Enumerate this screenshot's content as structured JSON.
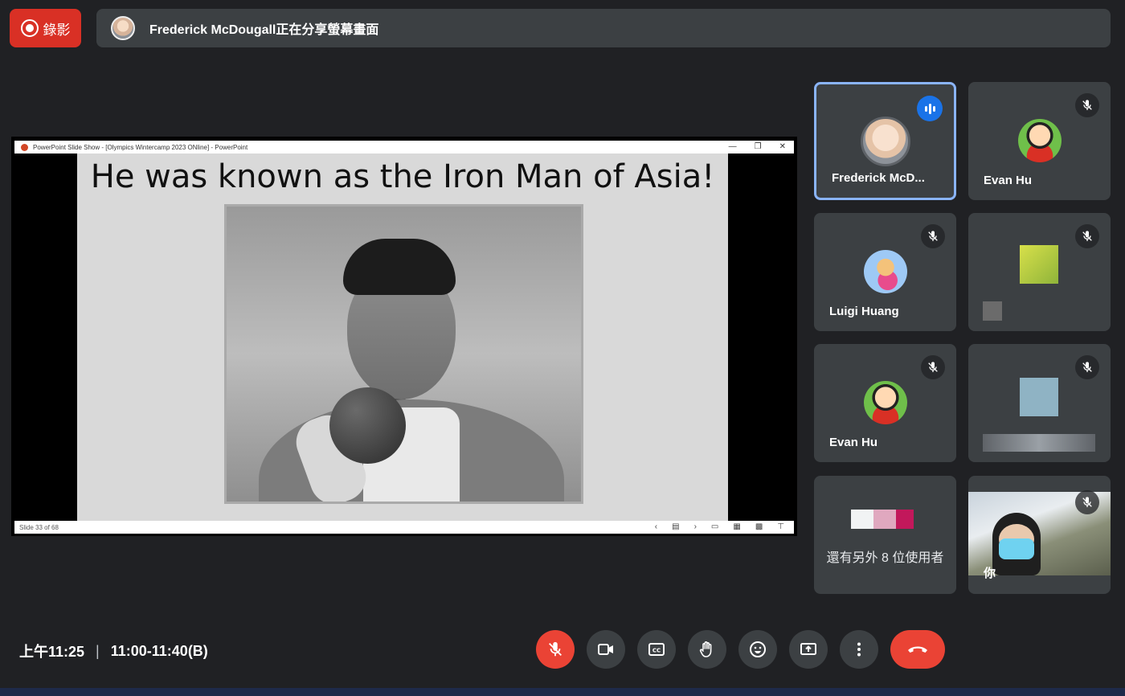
{
  "topbar": {
    "record_label": "錄影",
    "share_text": "Frederick McDougall正在分享螢幕畫面"
  },
  "presentation": {
    "window_title": "PowerPoint Slide Show - [Olympics Wintercamp 2023 ONline] - PowerPoint",
    "slide_title": "He was known as the Iron Man of Asia!",
    "slide_counter": "Slide 33 of 68"
  },
  "participants": [
    {
      "name": "Frederick McD...",
      "state": "speaking"
    },
    {
      "name": "Evan Hu",
      "state": "muted"
    },
    {
      "name": "Luigi Huang",
      "state": "muted"
    },
    {
      "name": "",
      "state": "muted"
    },
    {
      "name": "Evan Hu",
      "state": "muted"
    },
    {
      "name": "",
      "state": "muted"
    },
    {
      "name": "還有另外 8 位使用者",
      "state": "group"
    },
    {
      "name": "你",
      "state": "muted"
    }
  ],
  "bottombar": {
    "clock": "上午11:25",
    "separator": "|",
    "meeting_name": "11:00-11:40(B)"
  },
  "colors": {
    "background": "#202124",
    "tile": "#3c4043",
    "accent_blue": "#1a73e8",
    "danger_red": "#ea4335"
  }
}
